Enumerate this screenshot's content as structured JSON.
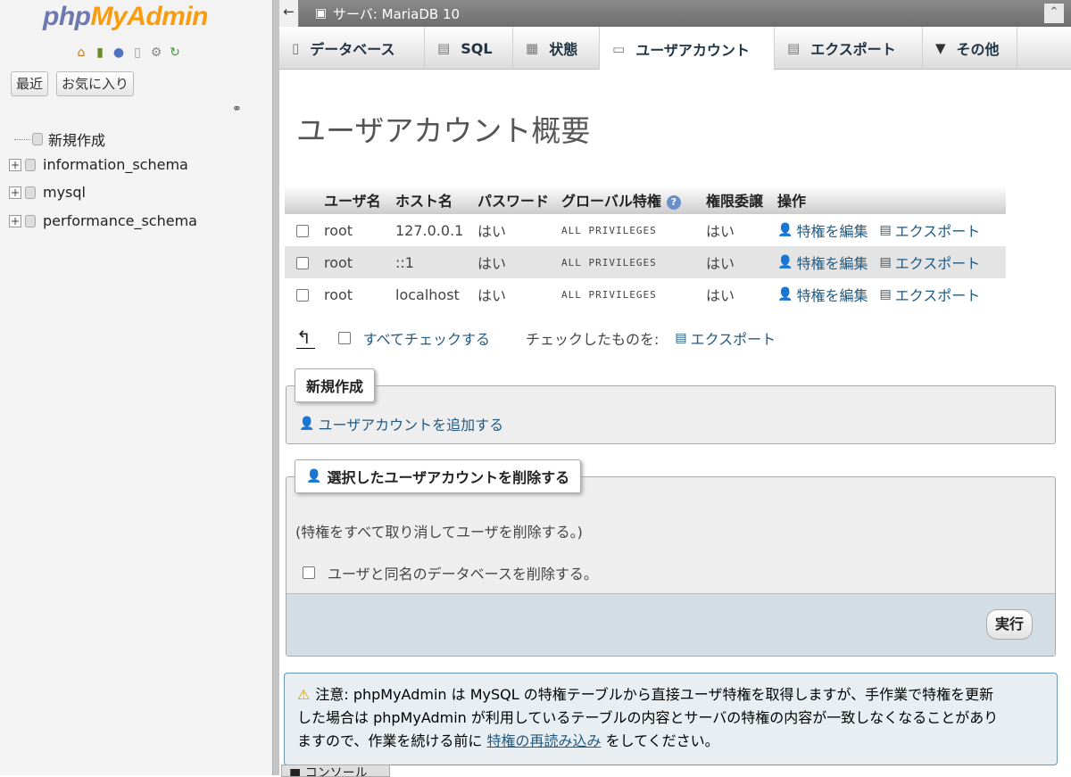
{
  "nav": {
    "logo_php": "php",
    "logo_ma": "MyAdmin",
    "recent_btn": "最近",
    "fav_btn": "お気に入り",
    "new_item": "新規作成",
    "databases": [
      "information_schema",
      "mysql",
      "performance_schema"
    ]
  },
  "topbar": {
    "back": "←",
    "server": "サーバ: MariaDB 10",
    "collapse": "⌃"
  },
  "tabs": [
    {
      "label": "データベース",
      "icon": "▯"
    },
    {
      "label": "SQL",
      "icon": "▤"
    },
    {
      "label": "状態",
      "icon": "▦"
    },
    {
      "label": "ユーザアカウント",
      "icon": "▭"
    },
    {
      "label": "エクスポート",
      "icon": "▤"
    },
    {
      "label": "その他",
      "icon": "▼"
    }
  ],
  "page_title": "ユーザアカウント概要",
  "table": {
    "headers": [
      "ユーザ名",
      "ホスト名",
      "パスワード",
      "グローバル特権",
      "権限委譲",
      "操作"
    ],
    "rows": [
      {
        "user": "root",
        "host": "127.0.0.1",
        "password": "はい",
        "privs": "ALL PRIVILEGES",
        "grant": "はい"
      },
      {
        "user": "root",
        "host": "::1",
        "password": "はい",
        "privs": "ALL PRIVILEGES",
        "grant": "はい"
      },
      {
        "user": "root",
        "host": "localhost",
        "password": "はい",
        "privs": "ALL PRIVILEGES",
        "grant": "はい"
      }
    ],
    "edit_label": "特権を編集",
    "export_label": "エクスポート"
  },
  "bulk": {
    "check_all": "すべてチェックする",
    "with_selected": "チェックしたものを:",
    "export": "エクスポート"
  },
  "new_section": {
    "legend": "新規作成",
    "add_user": "ユーザアカウントを追加する"
  },
  "delete_section": {
    "legend": "選択したユーザアカウントを削除する",
    "note": "(特権をすべて取り消してユーザを削除する。)",
    "drop_db": "ユーザと同名のデータベースを削除する。",
    "execute": "実行"
  },
  "notice": {
    "text1": "注意: phpMyAdmin は MySQL の特権テーブルから直接ユーザ特権を取得しますが、手作業で特権を更新",
    "text2": "した場合は phpMyAdmin が利用しているテーブルの内容とサーバの特権の内容が一致しなくなることがあり",
    "text3a": "ますので、作業を続ける前に",
    "link": "特権の再読み込み",
    "text3b": "をしてください。"
  },
  "console": "コンソール"
}
